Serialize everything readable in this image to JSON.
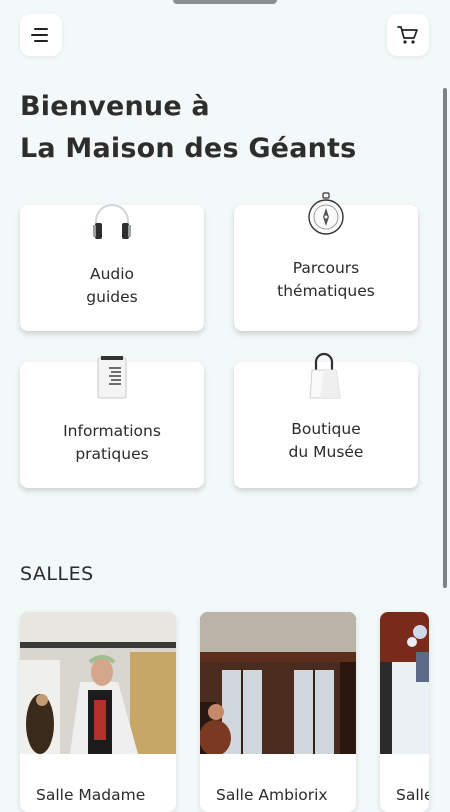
{
  "header": {
    "menu_icon": "menu-icon",
    "cart_icon": "cart-icon"
  },
  "welcome": {
    "line1": "Bienvenue à",
    "line2": "La Maison des Géants"
  },
  "cards": [
    {
      "id": "audio",
      "icon": "headphones-icon",
      "line1": "Audio",
      "line2": "guides"
    },
    {
      "id": "parcours",
      "icon": "compass-icon",
      "line1": "Parcours",
      "line2": "thématiques"
    },
    {
      "id": "infos",
      "icon": "document-icon",
      "line1": "Informations",
      "line2": "pratiques"
    },
    {
      "id": "boutique",
      "icon": "shopping-bag-icon",
      "line1": "Boutique",
      "line2": "du Musée"
    }
  ],
  "rooms_section": {
    "title": "SALLES",
    "rooms": [
      {
        "name": "Salle Madame"
      },
      {
        "name": "Salle Ambiorix"
      },
      {
        "name": "Salle"
      }
    ]
  },
  "colors": {
    "background": "#f3f8f8",
    "card": "#ffffff",
    "text": "#2b2b2b"
  }
}
